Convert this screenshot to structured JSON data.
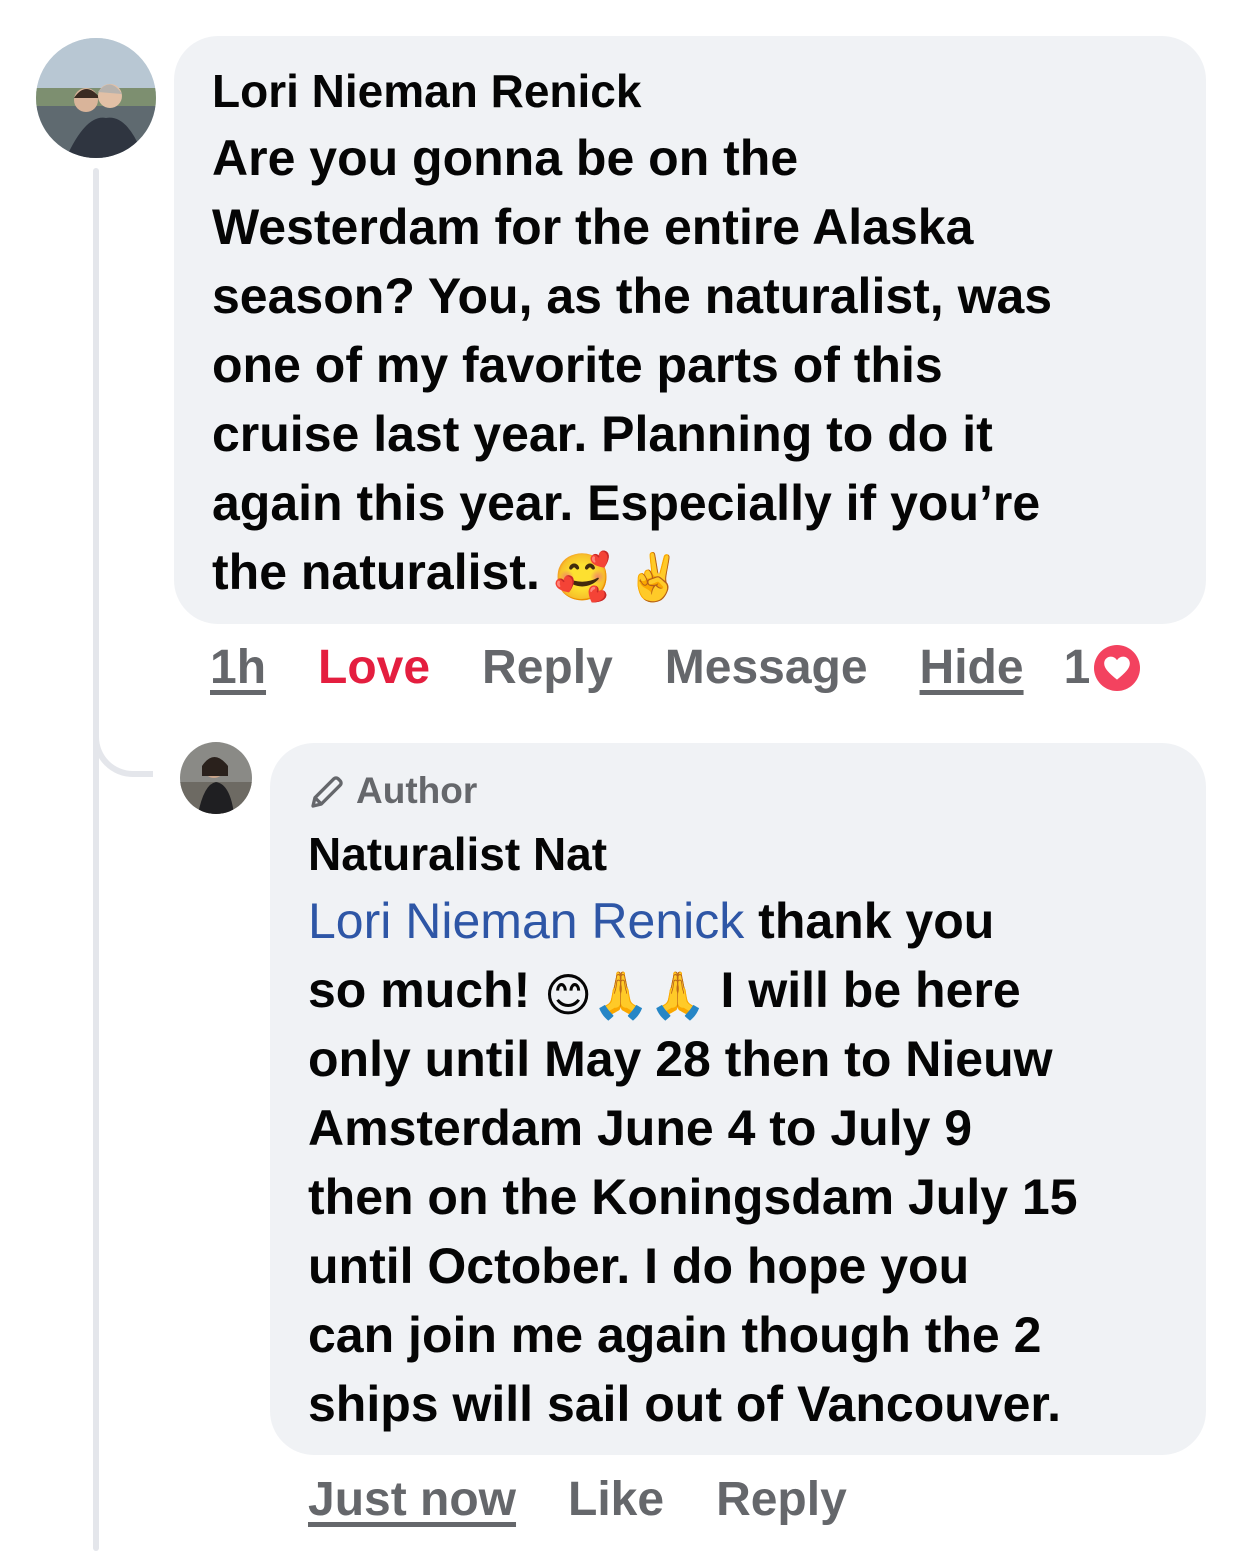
{
  "comment": {
    "author": "Lori Nieman Renick",
    "text": "Are you gonna be on the\nWesterdam for the entire Alaska\nseason?  You, as the naturalist, was\none of my favorite parts of this\ncruise last year.  Planning to do it\nagain this year.  Especially if you’re\nthe naturalist.",
    "emoji_1": "🥰",
    "emoji_2": "✌️",
    "actions": {
      "time": "1h",
      "love": "Love",
      "reply": "Reply",
      "message": "Message",
      "hide": "Hide",
      "reaction_count": "1"
    }
  },
  "reply": {
    "badge": "Author",
    "author": "Naturalist Nat",
    "mention": "Lori Nieman Renick",
    "text_part_1": " thank you\nso much! ",
    "emojis": "😊🙏🙏",
    "text_part_2": " I will be here\nonly until May 28 then to Nieuw\nAmsterdam June 4 to July 9\nthen on the Koningsdam July 15\nuntil October.  I do hope you\ncan join me again though the 2\nships will sail out of Vancouver.",
    "actions": {
      "time": "Just now",
      "like": "Like",
      "reply": "Reply"
    }
  },
  "colors": {
    "bubble": "#f0f2f5",
    "mention": "#2e56a6",
    "love": "#e41e3f",
    "muted": "#65676b",
    "heart": "#f3425f"
  },
  "icons": [
    "pencil-icon",
    "heart-icon"
  ]
}
